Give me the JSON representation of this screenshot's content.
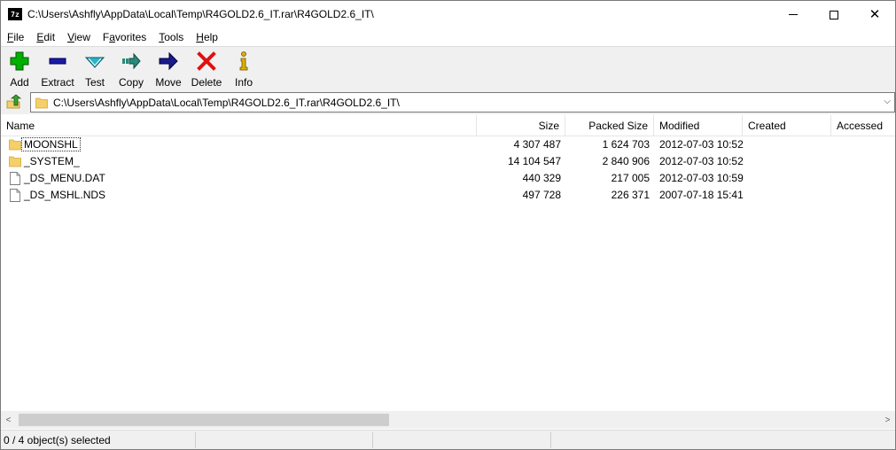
{
  "window": {
    "title": "C:\\Users\\Ashfly\\AppData\\Local\\Temp\\R4GOLD2.6_IT.rar\\R4GOLD2.6_IT\\",
    "app_icon_text": "7z",
    "minimize_glyph": "",
    "close_glyph": "✕"
  },
  "menu": {
    "items": [
      {
        "label": "File",
        "key": "F"
      },
      {
        "label": "Edit",
        "key": "E"
      },
      {
        "label": "View",
        "key": "V"
      },
      {
        "label": "Favorites",
        "key": "a"
      },
      {
        "label": "Tools",
        "key": "T"
      },
      {
        "label": "Help",
        "key": "H"
      }
    ]
  },
  "toolbar": {
    "add": "Add",
    "extract": "Extract",
    "test": "Test",
    "copy": "Copy",
    "move": "Move",
    "delete": "Delete",
    "info": "Info"
  },
  "colors": {
    "add": "#00b000",
    "extract": "#1a1aa8",
    "test": "#29b6c8",
    "copy": "#2a8a7a",
    "move": "#1a1a8a",
    "delete": "#e01010",
    "info": "#e0b000",
    "folder": "#f5cf67"
  },
  "address": {
    "path": "C:\\Users\\Ashfly\\AppData\\Local\\Temp\\R4GOLD2.6_IT.rar\\R4GOLD2.6_IT\\",
    "dropdown_glyph": "⌵"
  },
  "columns": {
    "name": "Name",
    "size": "Size",
    "packed": "Packed Size",
    "modified": "Modified",
    "created": "Created",
    "accessed": "Accessed"
  },
  "files": [
    {
      "name": "MOONSHL",
      "type": "folder",
      "size": "4 307 487",
      "packed": "1 624 703",
      "modified": "2012-07-03 10:52"
    },
    {
      "name": "_SYSTEM_",
      "type": "folder",
      "size": "14 104 547",
      "packed": "2 840 906",
      "modified": "2012-07-03 10:52"
    },
    {
      "name": "_DS_MENU.DAT",
      "type": "file",
      "size": "440 329",
      "packed": "217 005",
      "modified": "2012-07-03 10:59"
    },
    {
      "name": "_DS_MSHL.NDS",
      "type": "file",
      "size": "497 728",
      "packed": "226 371",
      "modified": "2007-07-18 15:41"
    }
  ],
  "scrollbar": {
    "left_glyph": "<",
    "right_glyph": ">"
  },
  "status": {
    "selection": "0 / 4 object(s) selected"
  }
}
